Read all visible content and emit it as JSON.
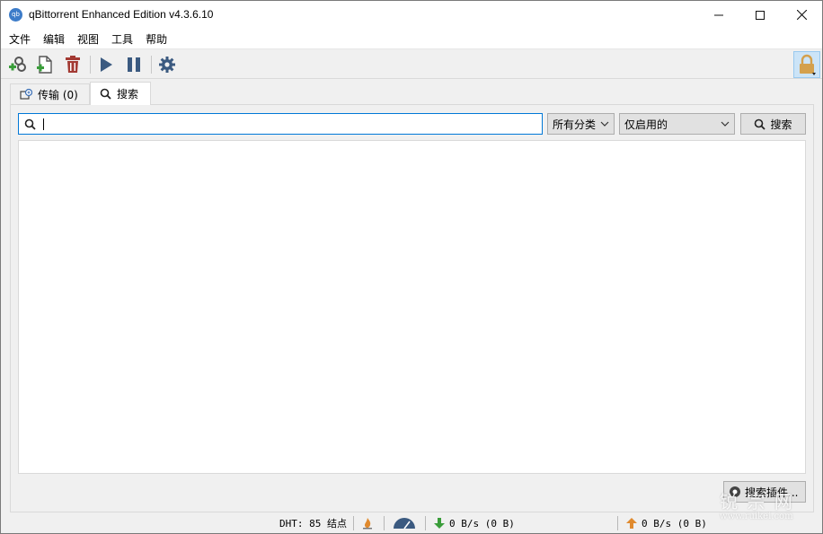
{
  "window": {
    "title": "qBittorrent Enhanced Edition v4.3.6.10",
    "app_icon_text": "qb",
    "minimize": "—",
    "maximize": "☐",
    "close": "✕"
  },
  "menu": {
    "items": [
      {
        "label": "文件"
      },
      {
        "label": "编辑"
      },
      {
        "label": "视图"
      },
      {
        "label": "工具"
      },
      {
        "label": "帮助"
      }
    ]
  },
  "toolbar": {
    "icons": [
      "add-link-icon",
      "add-file-icon",
      "delete-icon",
      "resume-icon",
      "pause-icon",
      "settings-icon",
      "lock-icon"
    ],
    "colors": {
      "green": "#3a9d3a",
      "red": "#a33a33",
      "blue": "#3b5a80",
      "lock": "#d4a04c"
    }
  },
  "tabs": [
    {
      "label": "传输 (0)",
      "icon": "transfer-icon",
      "active": false
    },
    {
      "label": "搜索",
      "icon": "search-icon",
      "active": true
    }
  ],
  "search": {
    "query": "",
    "category": "所有分类",
    "plugins": "仅启用的",
    "button_label": "搜索",
    "plugins_button_label": "搜索插件..."
  },
  "status": {
    "dht": "DHT: 85 结点",
    "download": "0 B/s (0 B)",
    "upload": "0 B/s (0 B)"
  },
  "watermark": {
    "big": "锐 宗 网",
    "small": "www.ruikei.com"
  }
}
